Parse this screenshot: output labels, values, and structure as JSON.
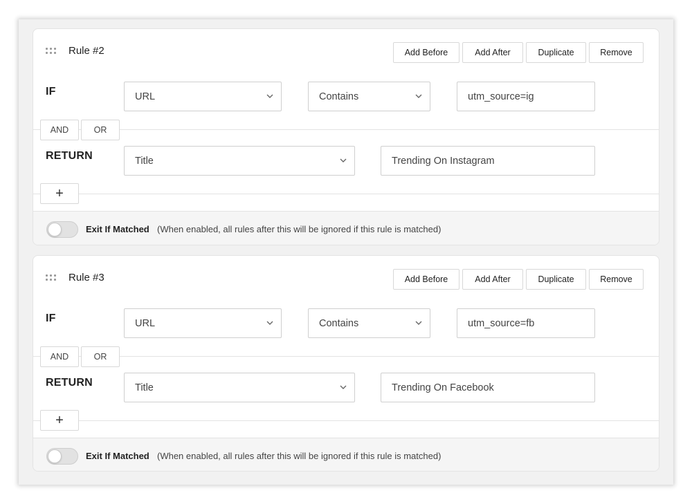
{
  "rules": [
    {
      "title": "Rule #2",
      "actions": {
        "add_before": "Add Before",
        "add_after": "Add After",
        "duplicate": "Duplicate",
        "remove": "Remove"
      },
      "if_label": "IF",
      "condition": {
        "field": "URL",
        "operator": "Contains",
        "value": "utm_source=ig"
      },
      "and_label": "AND",
      "or_label": "OR",
      "return_label": "RETURN",
      "return": {
        "field": "Title",
        "value": "Trending On Instagram"
      },
      "add_label": "+",
      "exit_label": "Exit If Matched",
      "exit_hint": "(When enabled, all rules after this will be ignored if this rule is matched)",
      "exit_enabled": false
    },
    {
      "title": "Rule #3",
      "actions": {
        "add_before": "Add Before",
        "add_after": "Add After",
        "duplicate": "Duplicate",
        "remove": "Remove"
      },
      "if_label": "IF",
      "condition": {
        "field": "URL",
        "operator": "Contains",
        "value": "utm_source=fb"
      },
      "and_label": "AND",
      "or_label": "OR",
      "return_label": "RETURN",
      "return": {
        "field": "Title",
        "value": "Trending On Facebook"
      },
      "add_label": "+",
      "exit_label": "Exit If Matched",
      "exit_hint": "(When enabled, all rules after this will be ignored if this rule is matched)",
      "exit_enabled": false
    }
  ],
  "icons": {
    "drag": "drag-handle-icon",
    "dropdown": "chevron-down-icon"
  }
}
